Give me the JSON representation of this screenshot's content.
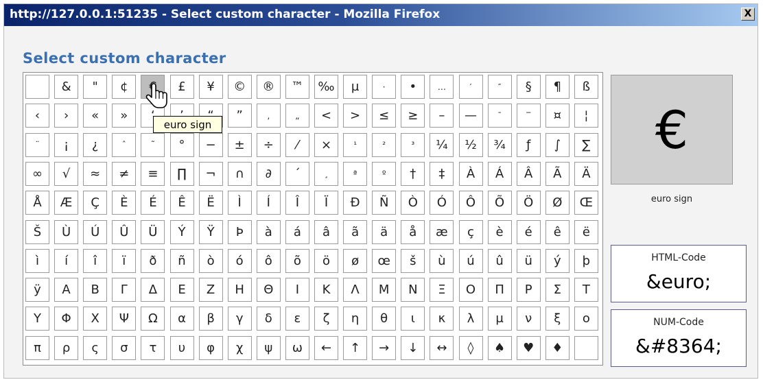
{
  "window": {
    "title": "http://127.0.0.1:51235 - Select custom character - Mozilla Firefox",
    "close_label": "X"
  },
  "dialog": {
    "heading": "Select custom character"
  },
  "characters": [
    [
      "",
      "&",
      "\"",
      "¢",
      "€",
      "£",
      "¥",
      "©",
      "®",
      "™",
      "‰",
      "µ",
      "·",
      "•",
      "…",
      "′",
      "″",
      "§",
      "¶",
      "ß"
    ],
    [
      "‹",
      "›",
      "«",
      "»",
      "‘",
      "’",
      "“",
      "”",
      "‚",
      "„",
      "<",
      ">",
      "≤",
      "≥",
      "–",
      "—",
      "¯",
      "‾",
      "¤",
      "¦"
    ],
    [
      "¨",
      "¡",
      "¿",
      "ˆ",
      "˜",
      "°",
      "−",
      "±",
      "÷",
      "⁄",
      "×",
      "¹",
      "²",
      "³",
      "¼",
      "½",
      "¾",
      "ƒ",
      "∫",
      "∑"
    ],
    [
      "∞",
      "√",
      "≈",
      "≠",
      "≡",
      "∏",
      "¬",
      "∩",
      "∂",
      "´",
      "¸",
      "ª",
      "º",
      "†",
      "‡",
      "À",
      "Á",
      "Â",
      "Ã",
      "Ä"
    ],
    [
      "Å",
      "Æ",
      "Ç",
      "È",
      "É",
      "Ê",
      "Ë",
      "Ì",
      "Í",
      "Î",
      "Ï",
      "Ð",
      "Ñ",
      "Ò",
      "Ó",
      "Ô",
      "Õ",
      "Ö",
      "Ø",
      "Œ"
    ],
    [
      "Š",
      "Ù",
      "Ú",
      "Û",
      "Ü",
      "Ý",
      "Ÿ",
      "Þ",
      "à",
      "á",
      "â",
      "ã",
      "ä",
      "å",
      "æ",
      "ç",
      "è",
      "é",
      "ê",
      "ë"
    ],
    [
      "ì",
      "í",
      "î",
      "ï",
      "ð",
      "ñ",
      "ò",
      "ó",
      "ô",
      "õ",
      "ö",
      "ø",
      "œ",
      "š",
      "ù",
      "ú",
      "û",
      "ü",
      "ý",
      "þ"
    ],
    [
      "ÿ",
      "Α",
      "Β",
      "Γ",
      "Δ",
      "Ε",
      "Ζ",
      "Η",
      "Θ",
      "Ι",
      "Κ",
      "Λ",
      "Μ",
      "Ν",
      "Ξ",
      "Ο",
      "Π",
      "Ρ",
      "Σ",
      "Τ"
    ],
    [
      "Υ",
      "Φ",
      "Χ",
      "Ψ",
      "Ω",
      "α",
      "β",
      "γ",
      "δ",
      "ε",
      "ζ",
      "η",
      "θ",
      "ι",
      "κ",
      "λ",
      "μ",
      "ν",
      "ξ",
      "ο"
    ],
    [
      "π",
      "ρ",
      "ς",
      "σ",
      "τ",
      "υ",
      "φ",
      "χ",
      "ψ",
      "ω",
      "←",
      "↑",
      "→",
      "↓",
      "↔",
      "◊",
      "♠",
      "♥",
      "♦",
      ""
    ]
  ],
  "hovered": {
    "row": 0,
    "col": 4
  },
  "tooltip": "euro sign",
  "preview": {
    "char": "€",
    "name": "euro sign"
  },
  "html_code": {
    "label": "HTML-Code",
    "value": "&euro;"
  },
  "num_code": {
    "label": "NUM-Code",
    "value": "&#8364;"
  },
  "cursor_icon": "hand-pointer-icon",
  "colors": {
    "heading": "#3a6fb0",
    "titlebar_start": "#0a246a",
    "titlebar_end": "#a6caf0",
    "hover_cell": "#bdbdbd",
    "preview_bg": "#d0d0d0",
    "tooltip_bg": "#ffffe1"
  }
}
